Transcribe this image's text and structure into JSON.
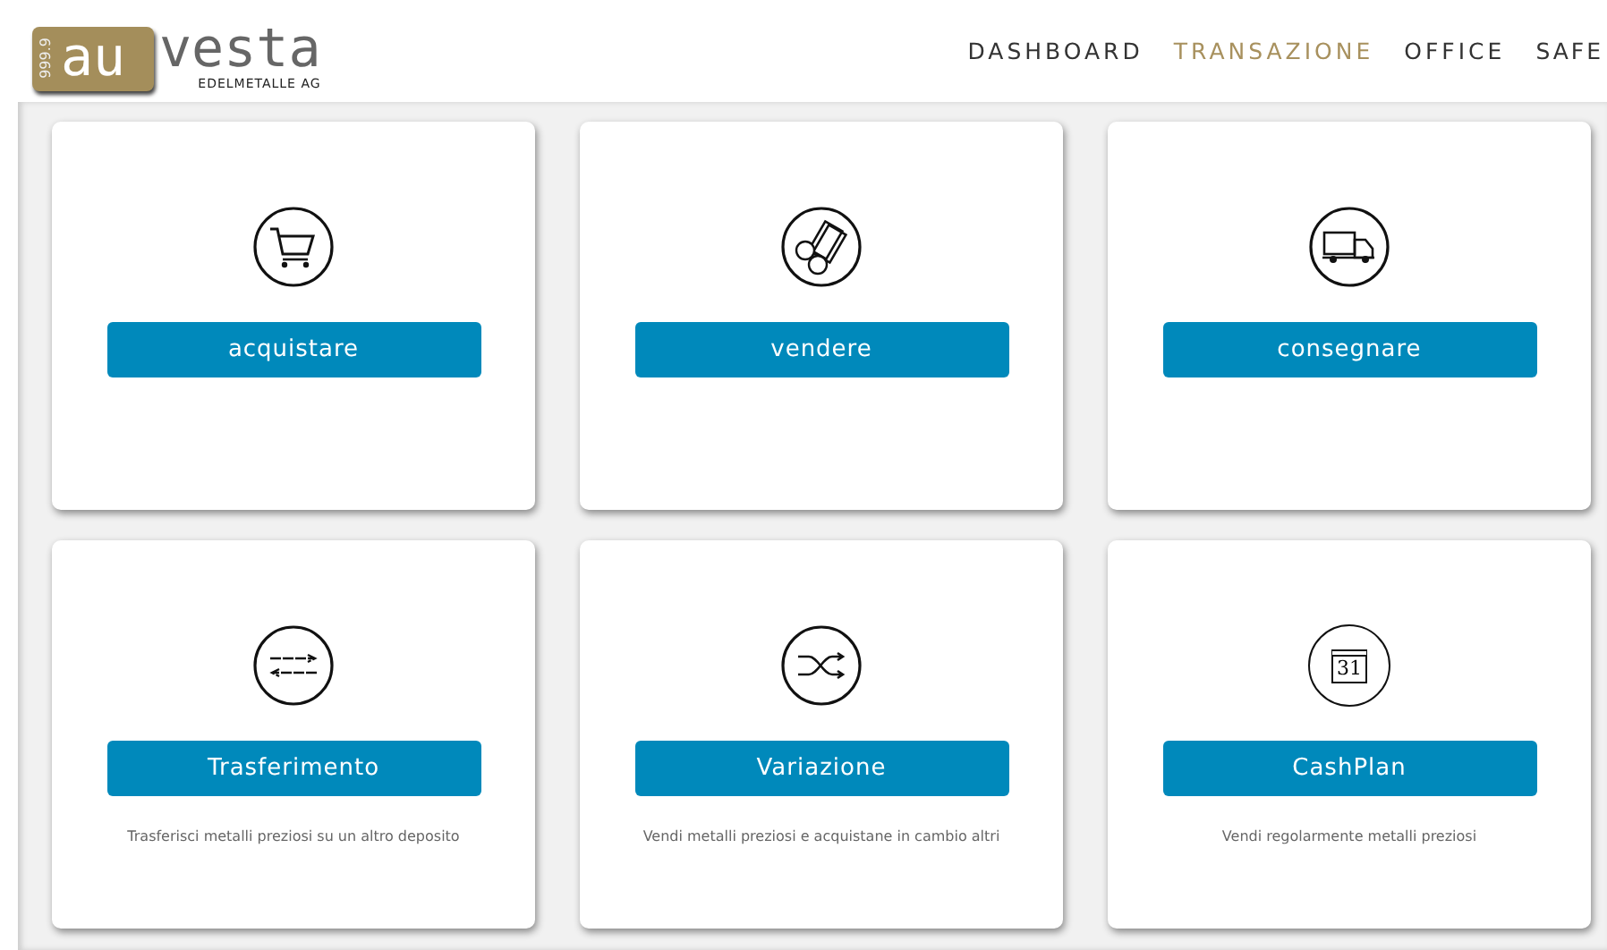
{
  "logo": {
    "purity": "999.9",
    "brand_highlight": "au",
    "brand_rest": "vesta",
    "tagline": "EDELMETALLE AG"
  },
  "nav": [
    {
      "label": "DASHBOARD",
      "selected": false
    },
    {
      "label": "TRANSAZIONE",
      "selected": true
    },
    {
      "label": "OFFICE",
      "selected": false
    },
    {
      "label": "SAFE",
      "selected": false
    }
  ],
  "cards": [
    {
      "kind": "cart",
      "button": "acquistare"
    },
    {
      "kind": "money",
      "button": "vendere"
    },
    {
      "kind": "truck",
      "button": "consegnare"
    },
    {
      "kind": "transfer",
      "button": "Trasferimento",
      "description": "Trasferisci metalli preziosi su un altro deposito"
    },
    {
      "kind": "shuffle",
      "button": "Variazione",
      "description": "Vendi metalli preziosi e acquistane in cambio altri"
    },
    {
      "kind": "calendar",
      "button": "CashPlan",
      "description": "Vendi regolarmente metalli preziosi",
      "icon_text": "31"
    }
  ]
}
